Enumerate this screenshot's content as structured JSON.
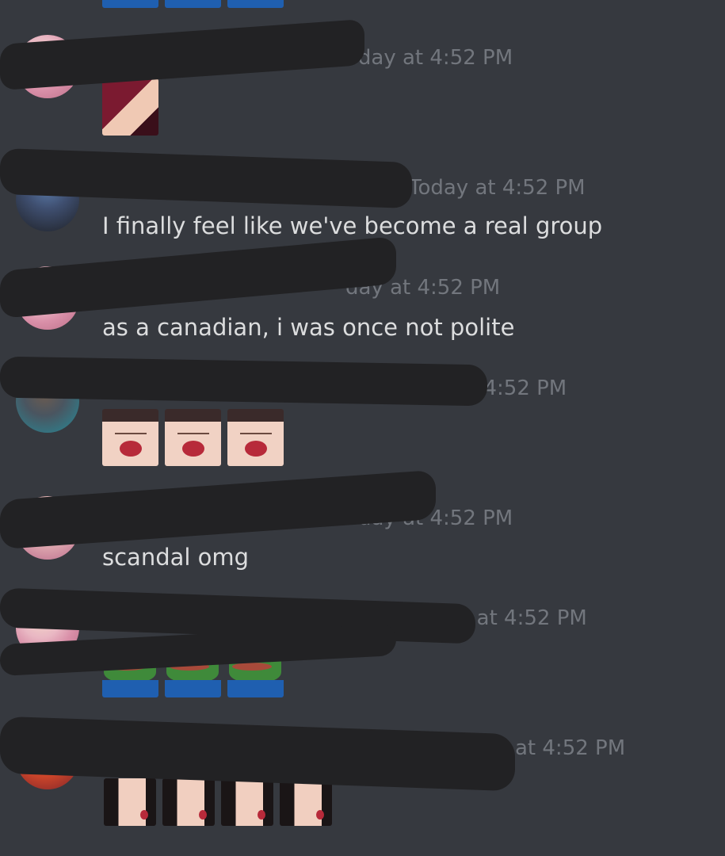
{
  "colors": {
    "background": "#36393f",
    "message_text": "#dcddde",
    "timestamp_text": "#72767d",
    "redaction": "#222224",
    "username_green": "#2ecc40",
    "username_magenta": "#c42bd6"
  },
  "messages": [
    {
      "timestamp": "oday at 4:52 PM",
      "text": "",
      "emotes": [
        "red-hair-girl-emote"
      ]
    },
    {
      "timestamp": "Today at 4:52 PM",
      "text": "I finally feel like we've become a real group",
      "emotes": []
    },
    {
      "timestamp": "day at 4:52 PM",
      "text": "as a canadian, i was once not polite",
      "emotes": []
    },
    {
      "timestamp": "day at 4:52 PM",
      "text": "",
      "emotes": [
        "surprised-face-emote",
        "surprised-face-emote",
        "surprised-face-emote"
      ]
    },
    {
      "timestamp": "day at 4:52 PM",
      "text": "scandal omg",
      "emotes": []
    },
    {
      "timestamp": "y at 4:52 PM",
      "text": "",
      "emotes": [
        "pepe-emote",
        "pepe-emote",
        "pepe-emote"
      ]
    },
    {
      "timestamp": "at 4:52 PM",
      "text": "",
      "emotes": [
        "shocked-girl-emote",
        "shocked-girl-emote",
        "shocked-girl-emote",
        "shocked-girl-emote"
      ]
    }
  ]
}
